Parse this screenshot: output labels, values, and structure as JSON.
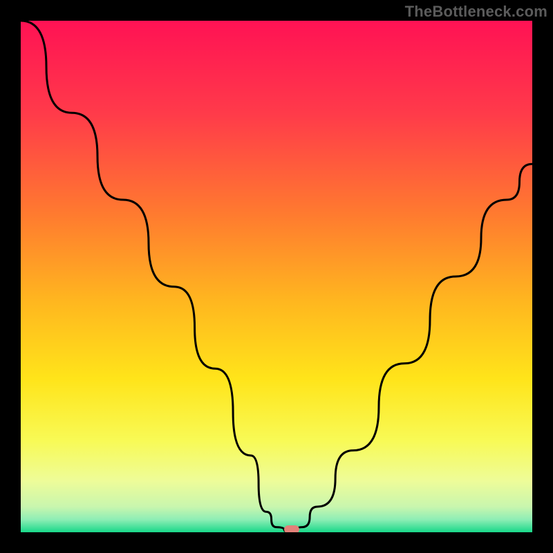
{
  "watermark": "TheBottleneck.com",
  "chart_data": {
    "type": "line",
    "title": "",
    "xlabel": "",
    "ylabel": "",
    "xlim": [
      0,
      100
    ],
    "ylim": [
      0,
      100
    ],
    "series": [
      {
        "name": "bottleneck-curve",
        "x": [
          0,
          10,
          20,
          30,
          38,
          45,
          48,
          50,
          53,
          55,
          58,
          65,
          75,
          85,
          95,
          100
        ],
        "values": [
          100,
          82,
          65,
          48,
          32,
          15,
          4,
          1,
          0,
          1,
          5,
          16,
          33,
          50,
          65,
          72
        ]
      }
    ],
    "marker": {
      "x": 53,
      "y": 0
    },
    "gradient_stops": [
      {
        "pos": 0,
        "color": "#ff1254"
      },
      {
        "pos": 0.18,
        "color": "#ff3a4a"
      },
      {
        "pos": 0.38,
        "color": "#ff7b2f"
      },
      {
        "pos": 0.55,
        "color": "#ffb71f"
      },
      {
        "pos": 0.7,
        "color": "#ffe41a"
      },
      {
        "pos": 0.82,
        "color": "#f8fa55"
      },
      {
        "pos": 0.9,
        "color": "#eefc99"
      },
      {
        "pos": 0.95,
        "color": "#c9f6ae"
      },
      {
        "pos": 0.975,
        "color": "#8eeeb5"
      },
      {
        "pos": 1.0,
        "color": "#18d889"
      }
    ]
  }
}
